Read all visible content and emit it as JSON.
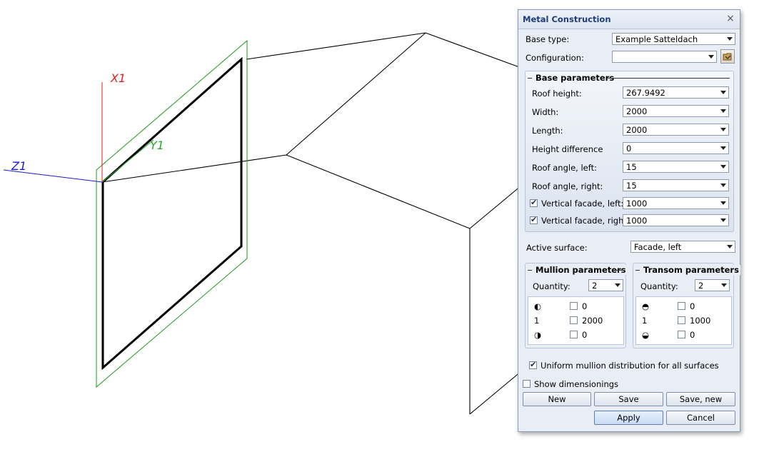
{
  "viewport": {
    "axes": {
      "x_label": "X1",
      "y_label": "Y1",
      "z_label": "Z1"
    },
    "colors": {
      "x_axis": "#e02020",
      "y_axis": "#22aa22",
      "z_axis": "#1a1ad0",
      "frame_outline": "#1c9b1c",
      "geometry": "#000000"
    }
  },
  "dialog": {
    "title": "Metal Construction",
    "close_label": "×",
    "base_type": {
      "label": "Base type:",
      "value": "Example Satteldach"
    },
    "configuration": {
      "label": "Configuration:",
      "value": ""
    },
    "base_parameters": {
      "title": "Base parameters",
      "rows": [
        {
          "label": "Roof height:",
          "value": "267.9492"
        },
        {
          "label": "Width:",
          "value": "2000"
        },
        {
          "label": "Length:",
          "value": "2000"
        },
        {
          "label": "Height difference",
          "value": "0"
        },
        {
          "label": "Roof angle, left:",
          "value": "15"
        },
        {
          "label": "Roof angle, right:",
          "value": "15"
        },
        {
          "label": "Vertical facade, left:",
          "value": "1000",
          "checked": true
        },
        {
          "label": "Vertical facade, right:",
          "value": "1000",
          "checked": true
        }
      ]
    },
    "active_surface": {
      "label": "Active surface:",
      "value": "Facade, left"
    },
    "mullion": {
      "title": "Mullion parameters",
      "quantity_label": "Quantity:",
      "quantity": "2",
      "rows": [
        {
          "icon": "◐",
          "value": "0"
        },
        {
          "icon": "1",
          "value": "2000"
        },
        {
          "icon": "◑",
          "value": "0"
        }
      ]
    },
    "transom": {
      "title": "Transom parameters",
      "quantity_label": "Quantity:",
      "quantity": "2",
      "rows": [
        {
          "icon": "◓",
          "value": "0"
        },
        {
          "icon": "1",
          "value": "1000"
        },
        {
          "icon": "◒",
          "value": "0"
        }
      ]
    },
    "uniform_label": "Uniform mullion distribution for all surfaces",
    "uniform_checked": true,
    "show_dimensionings_label": "Show dimensionings",
    "show_dimensionings_checked": false,
    "buttons": {
      "new": "New",
      "save": "Save",
      "save_new": "Save, new",
      "apply": "Apply",
      "cancel": "Cancel"
    }
  }
}
